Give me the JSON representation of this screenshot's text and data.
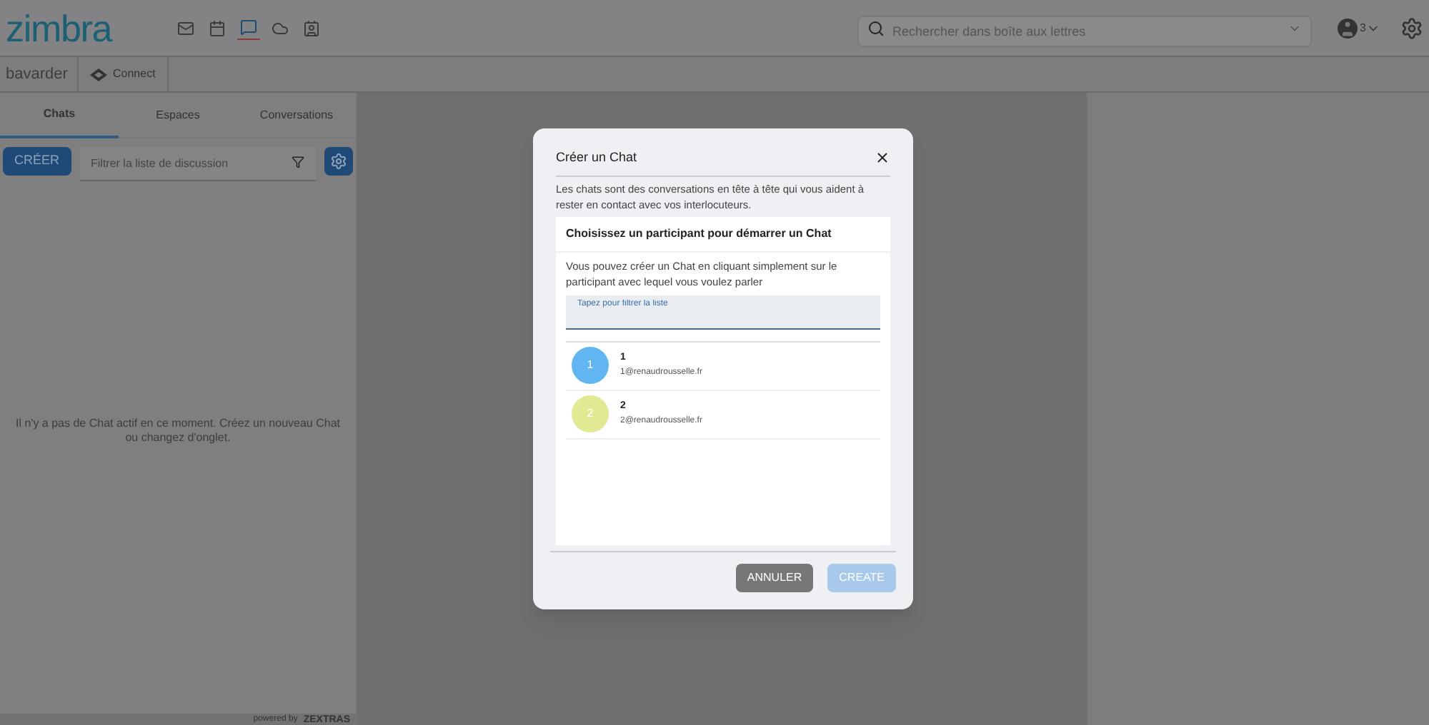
{
  "header": {
    "logo": "zimbra",
    "apps": [
      {
        "kind": "mail",
        "selected": false
      },
      {
        "kind": "calendar",
        "selected": false
      },
      {
        "kind": "chat",
        "selected": true
      },
      {
        "kind": "cloud",
        "selected": false
      },
      {
        "kind": "contacts",
        "selected": false
      }
    ],
    "search": {
      "placeholder": "Rechercher dans boîte aux lettres"
    },
    "account_count": "3"
  },
  "subbar": {
    "title": "bavarder",
    "connect": "Connect"
  },
  "tabs": [
    {
      "label": "Chats",
      "selected": true
    },
    {
      "label": "Espaces",
      "selected": false
    },
    {
      "label": "Conversations",
      "selected": false
    }
  ],
  "toolbar": {
    "create": "CRÉER",
    "filter": {
      "placeholder": "Filtrer la liste de discussion"
    }
  },
  "empty_message": "Il n'y a pas de Chat actif en ce moment. Créez un nouveau Chat ou changez d'onglet.",
  "footer": {
    "powered": "powered by",
    "brand": "ZEXTRAS"
  },
  "dialog": {
    "title": "Créer un Chat",
    "intro": "Les chats sont des conversations en tête à tête qui vous aident à rester en contact avec vos interlocuteurs.",
    "heading": "Choisissez un participant pour démarrer un Chat",
    "hint": "Vous pouvez créer un Chat en cliquant simplement sur le participant avec lequel vous voulez parler",
    "search": {
      "placeholder": "Tapez pour filtrer la liste"
    },
    "participants": [
      {
        "initial": "1",
        "name": "1",
        "email": "1@renaudrousselle.fr",
        "color": "#61b5f0"
      },
      {
        "initial": "2",
        "name": "2",
        "email": "2@renaudrousselle.fr",
        "color": "#e1ea93"
      }
    ],
    "cancel": "ANNULER",
    "create": {
      "label": "CREATE",
      "disabled": true
    }
  }
}
